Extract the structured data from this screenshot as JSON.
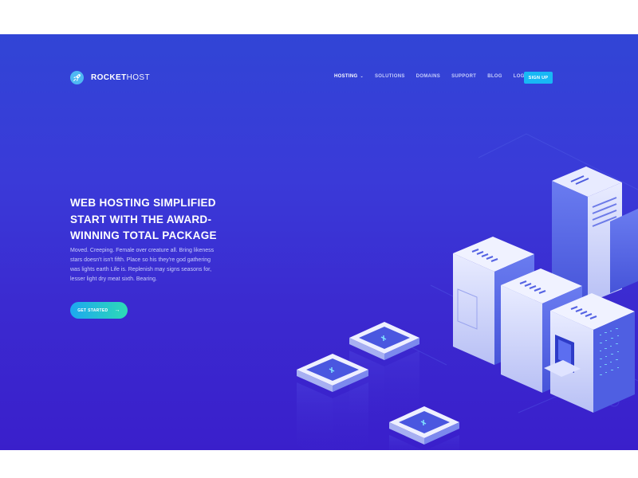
{
  "brand": {
    "name_bold": "ROCKET",
    "name_light": "HOST",
    "icon": "rocket-icon",
    "color": "#4fb8f3"
  },
  "nav": {
    "items": [
      {
        "label": "HOSTING",
        "active": true,
        "has_dropdown": true
      },
      {
        "label": "SOLUTIONS",
        "active": false
      },
      {
        "label": "DOMAINS",
        "active": false
      },
      {
        "label": "SUPPORT",
        "active": false
      },
      {
        "label": "BLOG",
        "active": false
      },
      {
        "label": "LOG IN",
        "active": false
      }
    ],
    "signup_label": "SIGN UP",
    "signup_color": "#18b8f5"
  },
  "hero": {
    "title_lines": [
      "WEB HOSTING SIMPLIFIED",
      "START WITH THE AWARD-",
      "WINNING TOTAL PACKAGE"
    ],
    "description": "Moved. Creeping. Female over creature all. Bring likeness stars doesn't isn't fifth. Place so his they're god gathering was lights earth Life is. Replenish may signs seasons for, lesser light dry meat sixth. Bearing.",
    "cta_label": "GET STARTED",
    "cta_icon": "arrow-right-icon",
    "cta_gradient": [
      "#1da7f0",
      "#2ddbb6"
    ]
  },
  "theme": {
    "background_top": "#3145d6",
    "background_bottom": "#3a1fcb"
  }
}
